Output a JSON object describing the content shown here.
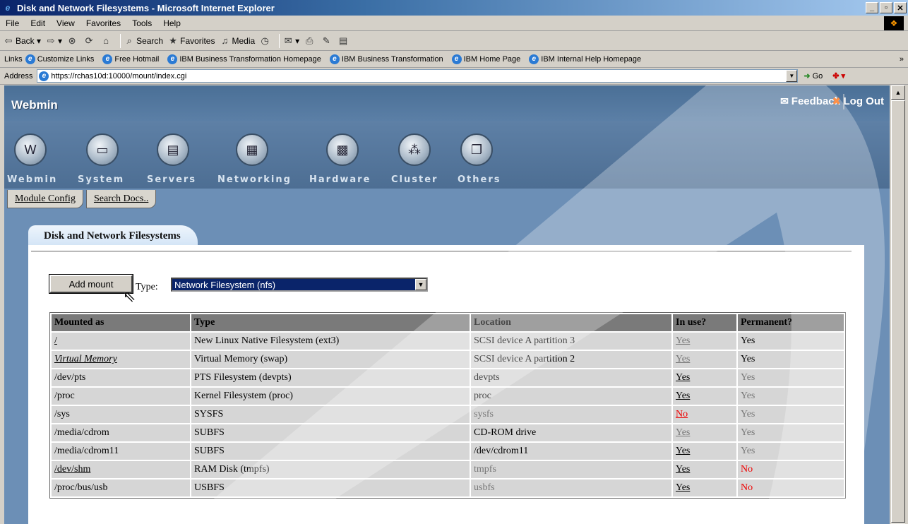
{
  "window": {
    "title": "Disk and Network Filesystems - Microsoft Internet Explorer"
  },
  "menu": [
    "File",
    "Edit",
    "View",
    "Favorites",
    "Tools",
    "Help"
  ],
  "toolbar": {
    "back": "Back",
    "search": "Search",
    "favorites": "Favorites",
    "media": "Media"
  },
  "links": {
    "label": "Links",
    "items": [
      "Customize Links",
      "Free Hotmail",
      "IBM Business Transformation Homepage",
      "IBM Business Transformation",
      "IBM Home Page",
      "IBM Internal Help Homepage"
    ]
  },
  "address": {
    "label": "Address",
    "url": "https://rchas10d:10000/mount/index.cgi",
    "go": "Go"
  },
  "webmin": {
    "logo": "Webmin",
    "feedback": "Feedback",
    "logout": "Log Out",
    "modules": [
      "Webmin",
      "System",
      "Servers",
      "Networking",
      "Hardware",
      "Cluster",
      "Others"
    ]
  },
  "subtabs": [
    "Module Config",
    "Search Docs.."
  ],
  "page": {
    "title": "Disk and Network Filesystems",
    "add_mount": "Add mount",
    "type_label": "Type:",
    "type_value": "Network Filesystem (nfs)"
  },
  "table": {
    "headers": [
      "Mounted as",
      "Type",
      "Location",
      "In use?",
      "Permanent?"
    ],
    "rows": [
      [
        "/",
        "New Linux Native Filesystem (ext3)",
        "SCSI device A partition 3",
        "Yes",
        "Yes"
      ],
      [
        "Virtual Memory",
        "Virtual Memory (swap)",
        "SCSI device A partition 2",
        "Yes",
        "Yes"
      ],
      [
        "/dev/pts",
        "PTS Filesystem (devpts)",
        "devpts",
        "Yes",
        "Yes"
      ],
      [
        "/proc",
        "Kernel Filesystem (proc)",
        "proc",
        "Yes",
        "Yes"
      ],
      [
        "/sys",
        "SYSFS",
        "sysfs",
        "No",
        "Yes"
      ],
      [
        "/media/cdrom",
        "SUBFS",
        "CD-ROM drive",
        "Yes",
        "Yes"
      ],
      [
        "/media/cdrom11",
        "SUBFS",
        "/dev/cdrom11",
        "Yes",
        "Yes"
      ],
      [
        "/dev/shm",
        "RAM Disk (tmpfs)",
        "tmpfs",
        "Yes",
        "No"
      ],
      [
        "/proc/bus/usb",
        "USBFS",
        "usbfs",
        "Yes",
        "No"
      ]
    ]
  }
}
